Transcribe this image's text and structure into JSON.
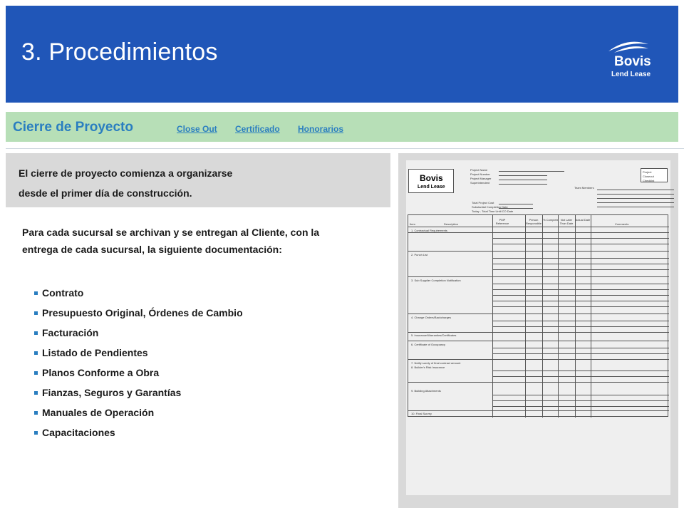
{
  "header": {
    "title": "3. Procedimientos",
    "logo_word": "Bovis",
    "logo_sub": "Lend Lease"
  },
  "subbar": {
    "title": "Cierre de Proyecto",
    "links": [
      "Close Out",
      "Certificado ",
      "Honorarios"
    ]
  },
  "intro": {
    "lines": [
      "El cierre de proyecto comienza a organizarse",
      "desde el primer día de construcción."
    ]
  },
  "paragraph": {
    "lines": [
      "Para cada sucursal se archivan y se entregan al Cliente, con la",
      "entrega de cada sucursal, la  siguiente documentación:"
    ]
  },
  "bullets": [
    "Contrato",
    "Presupuesto Original, Órdenes de Cambio",
    "Facturación",
    "Listado de Pendientes",
    "Planos Conforme a Obra",
    "Fianzas, Seguros y Garantías",
    "Manuales de Operación",
    "Capacitaciones"
  ],
  "form": {
    "logo_word": "Bovis",
    "logo_sub": "Lend Lease",
    "title_box": [
      "Project",
      "Closeout",
      "Checklist"
    ],
    "header_fields": [
      "Project Name",
      "Project Number",
      "Project Manager",
      "Superintendent"
    ],
    "lower_fields": [
      "Total Project Cost",
      "Substantial Completion Date",
      "Today - Total Time Until CO Date"
    ],
    "team_label": "Team Members",
    "columns": [
      "Item",
      "Description",
      "PMP Reference",
      "Person Responsible",
      "% Complete",
      "Not Later Than Date",
      "Actual Date",
      "Comments"
    ],
    "sections": [
      "1. Contractual Requirements",
      "2. Punch List",
      "3. Sub Supplier Completion Notification",
      "4. Change Orders/Backcharges",
      "5. Insurance/Warranties/Certificates",
      "6. Certificate of Occupancy",
      "7. Notify surety of final contract amount",
      "8. Builder's Risk Insurance",
      "9. Building Attachments",
      "10. Final Survey"
    ]
  }
}
